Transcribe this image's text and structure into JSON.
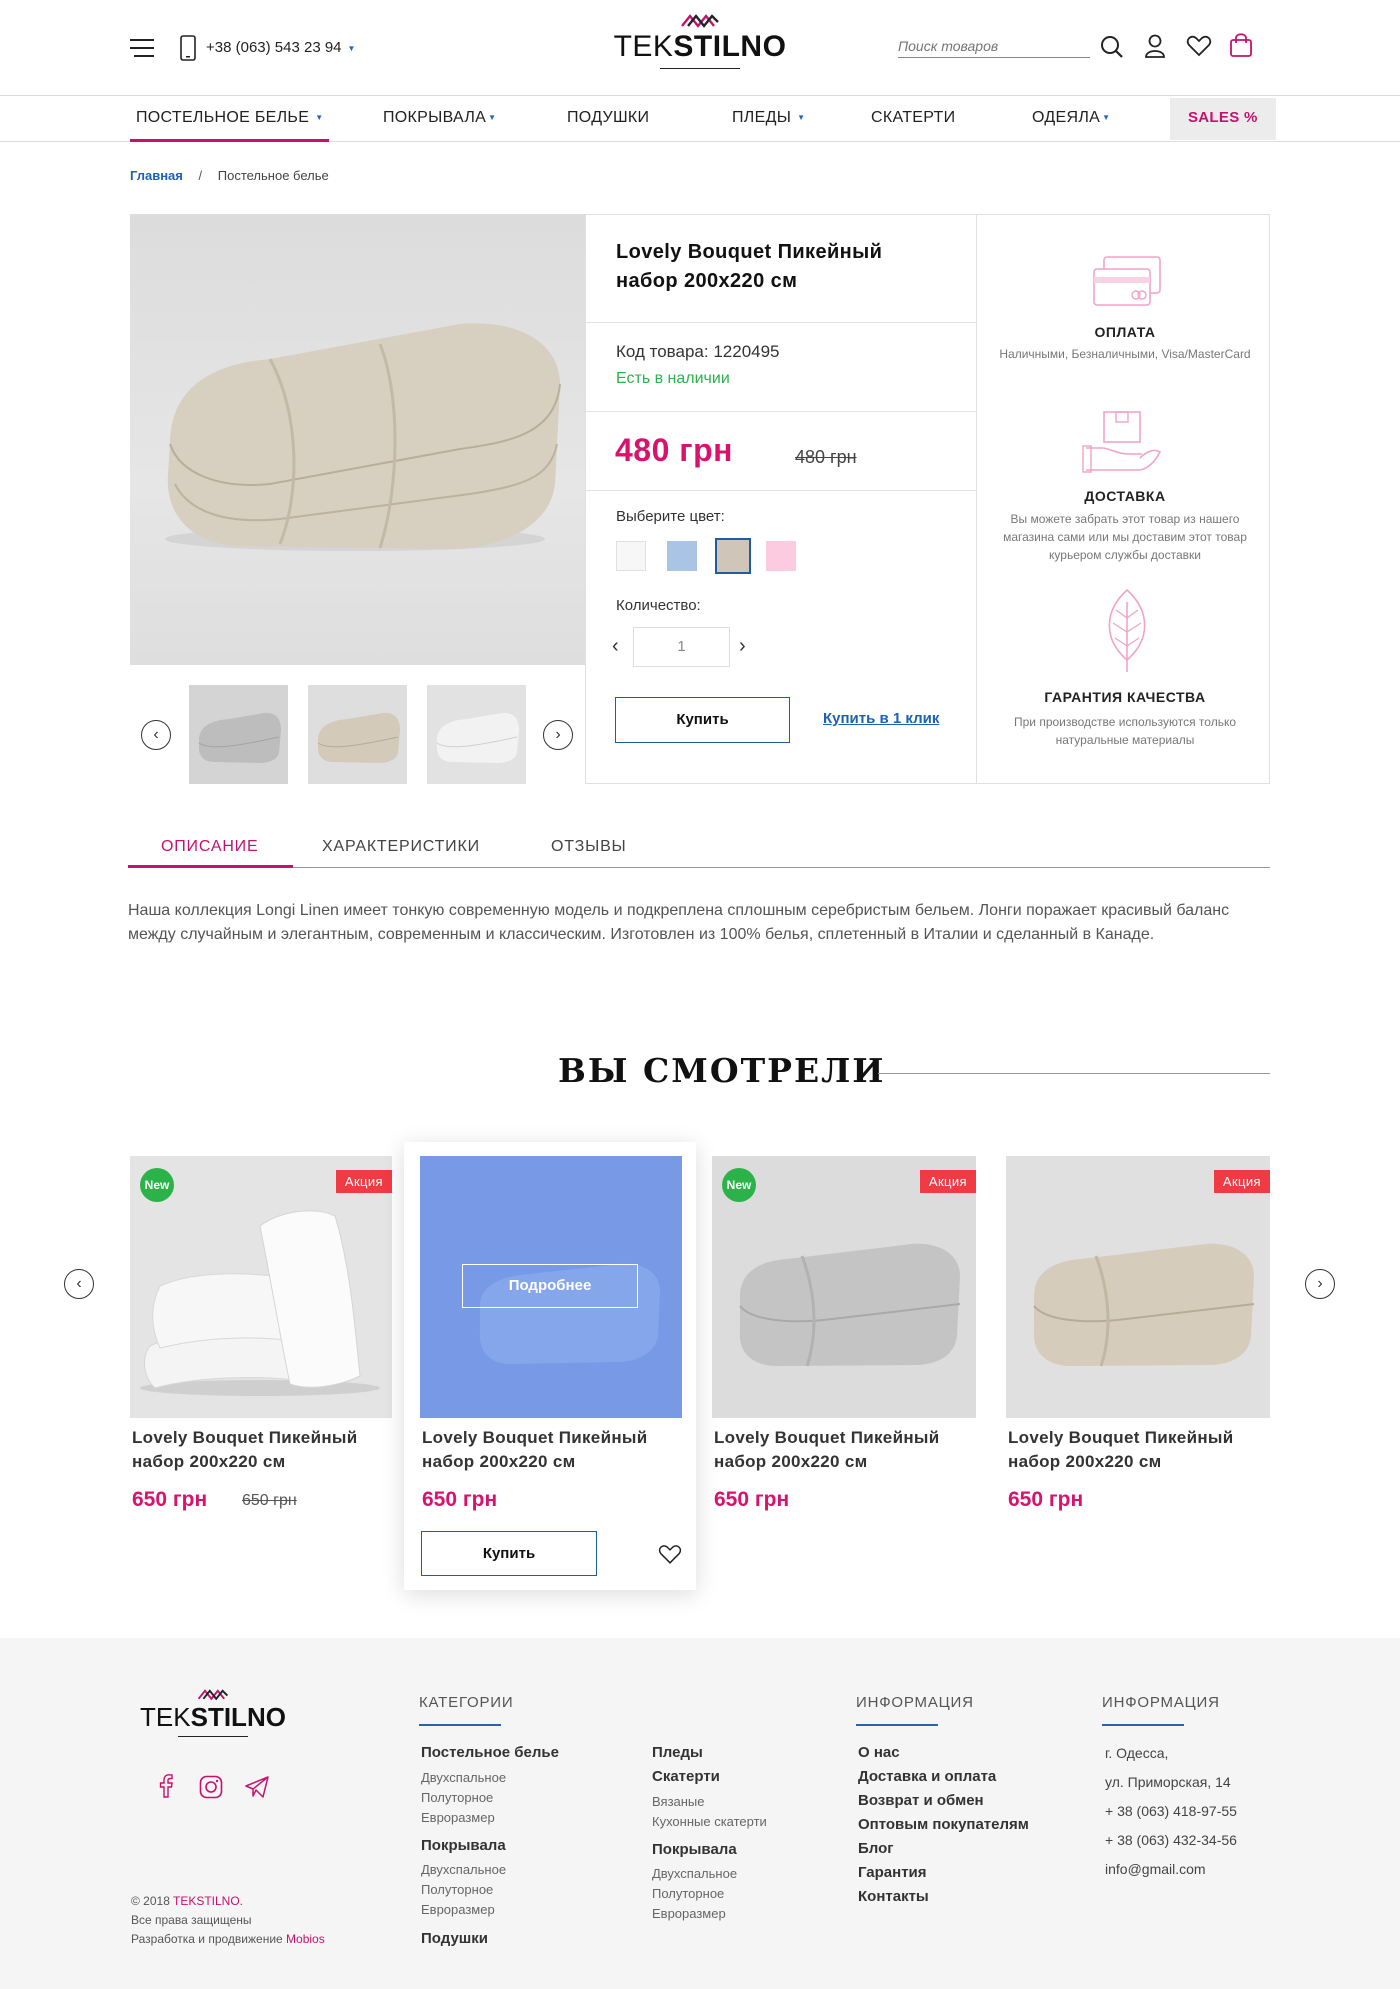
{
  "header": {
    "phone": "+38 (063) 543 23 94",
    "logo_part1": "TEK",
    "logo_part2": "STILNO",
    "search_placeholder": "Поиск товаров"
  },
  "nav": {
    "items": [
      "ПОСТЕЛЬНОЕ БЕЛЬЕ",
      "ПОКРЫВАЛА",
      "ПОДУШКИ",
      "ПЛЕДЫ",
      "СКАТЕРТИ",
      "ОДЕЯЛА"
    ],
    "sales": "SALES %"
  },
  "breadcrumb": {
    "home": "Главная",
    "separator": "/",
    "current": "Постельное белье"
  },
  "product": {
    "title": "Lovely Bouquet Пикейный набор 200x220 см",
    "code": "Код товара: 1220495",
    "availability": "Есть в наличии",
    "price": "480 грн",
    "old_price": "480 грн",
    "color_label": "Выберите цвет:",
    "colors": [
      "#f7f7f7",
      "#a9c4e5",
      "#cfc5b8",
      "#fccbe0"
    ],
    "selected_color": 2,
    "quantity_label": "Количество:",
    "quantity": "1",
    "buy_label": "Купить",
    "one_click_label": "Купить в 1 клик"
  },
  "features": [
    {
      "title": "ОПЛАТА",
      "text": "Наличными, Безналичными, Visa/MasterCard"
    },
    {
      "title": "ДОСТАВКА",
      "text": "Вы можете забрать этот товар из нашего магазина сами или мы доставим этот товар курьером службы доставки"
    },
    {
      "title": "ГАРАНТИЯ КАЧЕСТВА",
      "text": "При производстве используются только натуральные материалы"
    }
  ],
  "tabs": {
    "items": [
      "ОПИСАНИЕ",
      "ХАРАКТЕРИСТИКИ",
      "ОТЗЫВЫ"
    ],
    "active": 0,
    "description": "Наша коллекция Longi Linen имеет тонкую современную модель и подкреплена сплошным серебристым бельем. Лонги поражает красивый баланс между случайным и элегантным, современным и классическим. Изготовлен из 100% белья, сплетенный в Италии  и сделанный  в Канаде."
  },
  "viewed": {
    "title": "ВЫ СМОТРЕЛИ",
    "hover_label": "Подробнее",
    "buy_label": "Купить",
    "badge_new": "New",
    "badge_sale": "Акция",
    "items": [
      {
        "title": "Lovely Bouquet Пикейный набор 200x220 см",
        "price": "650 грн",
        "old_price": "650 грн"
      },
      {
        "title": "Lovely Bouquet Пикейный набор 200x220 см",
        "price": "650 грн"
      },
      {
        "title": "Lovely Bouquet Пикейный набор 200x220 см",
        "price": "650 грн"
      },
      {
        "title": "Lovely Bouquet Пикейный набор 200x220 см",
        "price": "650 грн"
      }
    ]
  },
  "footer": {
    "logo_part1": "TEK",
    "logo_part2": "STILNO",
    "copyright_prefix": "© 2018 ",
    "copyright_brand": "TEKSTILNO.",
    "rights": "Все права защищены",
    "dev_prefix": "Разработка и продвижение ",
    "dev_brand": "Mobios",
    "categories_title": "КАТЕГОРИИ",
    "col1": {
      "g1": "Постельное белье",
      "g1_items": [
        "Двухспальное",
        "Полуторное",
        "Евроразмер"
      ],
      "g2": "Покрывала",
      "g2_items": [
        "Двухспальное",
        "Полуторное",
        "Евроразмер"
      ],
      "g3": "Подушки"
    },
    "col2": {
      "g1": "Пледы",
      "g2": "Скатерти",
      "g2_items": [
        "Вязаные",
        "Кухонные скатерти"
      ],
      "g3": "Покрывала",
      "g3_items": [
        "Двухспальное",
        "Полуторное",
        "Евроразмер"
      ]
    },
    "info_title": "ИНФОРМАЦИЯ",
    "info_links": [
      "О нас",
      "Доставка и оплата",
      "Возврат и обмен",
      "Оптовым покупателям",
      "Блог",
      "Гарантия",
      "Контакты"
    ],
    "contacts_title": "ИНФОРМАЦИЯ",
    "contacts": [
      "г. Одесса,",
      "ул. Приморская, 14",
      "+ 38 (063) 418-97-55",
      "+ 38 (063) 432-34-56",
      "info@gmail.com"
    ]
  }
}
